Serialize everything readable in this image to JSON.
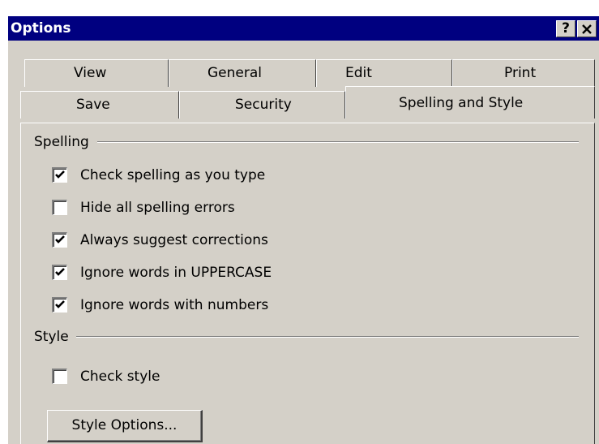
{
  "window": {
    "title": "Options",
    "help_button": "?",
    "close_button": "✕"
  },
  "tabs": {
    "back_row": [
      {
        "label": "View"
      },
      {
        "label": "General"
      },
      {
        "label": "Edit"
      },
      {
        "label": "Print"
      }
    ],
    "front_row": [
      {
        "label": "Save"
      },
      {
        "label": "Security"
      },
      {
        "label": "Spelling and Style",
        "selected": true
      }
    ]
  },
  "spelling": {
    "group_label": "Spelling",
    "options": [
      {
        "label": "Check spelling as you type",
        "checked": true
      },
      {
        "label": "Hide all spelling errors",
        "checked": false
      },
      {
        "label": "Always suggest corrections",
        "checked": true
      },
      {
        "label": "Ignore words in UPPERCASE",
        "checked": true
      },
      {
        "label": "Ignore words with numbers",
        "checked": true
      }
    ]
  },
  "style": {
    "group_label": "Style",
    "check_style": {
      "label": "Check style",
      "checked": false
    },
    "options_button": "Style Options..."
  },
  "colors": {
    "titlebar": "#000080",
    "face": "#d4d0c8",
    "titlebar_text": "#ffffff"
  }
}
